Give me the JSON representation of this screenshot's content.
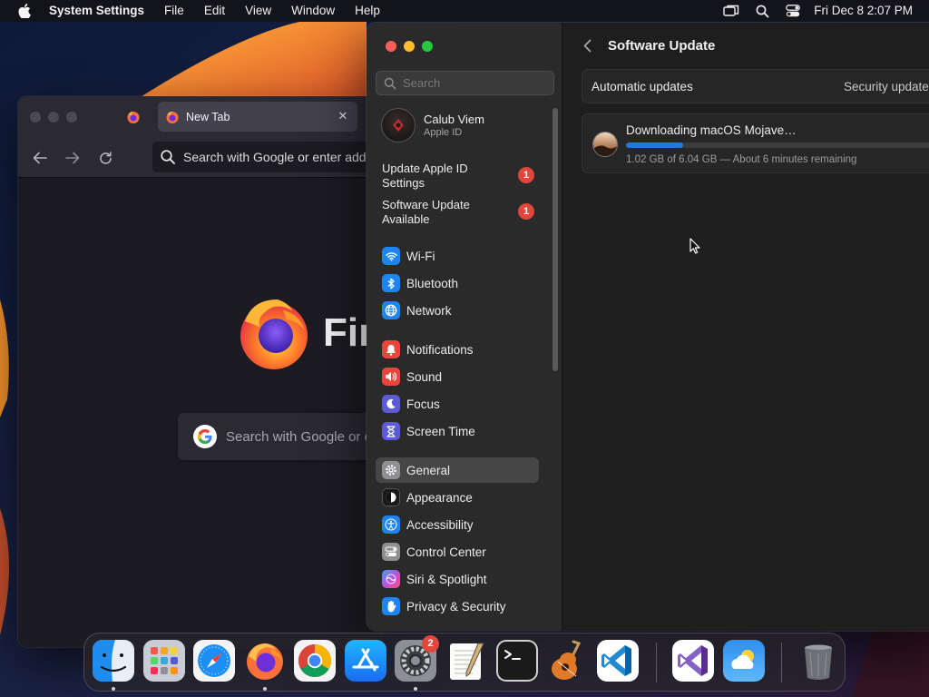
{
  "menubar": {
    "app_name": "System Settings",
    "menus": [
      "File",
      "Edit",
      "View",
      "Window",
      "Help"
    ],
    "clock": "Fri Dec 8  2:07 PM",
    "status_icons": [
      "screen-mirroring-icon",
      "spotlight-search-icon",
      "control-center-icon"
    ]
  },
  "firefox": {
    "tab_title": "New Tab",
    "url_placeholder": "Search with Google or enter address",
    "wordmark": "Firefox",
    "search_placeholder": "Search with Google or enter address"
  },
  "settings": {
    "search_placeholder": "Search",
    "account": {
      "name": "Calub Viem",
      "subtitle": "Apple ID"
    },
    "notices": [
      {
        "label_line1": "Update Apple ID",
        "label_line2": "Settings",
        "badge": "1"
      },
      {
        "label_line1": "Software Update",
        "label_line2": "Available",
        "badge": "1"
      }
    ],
    "nav_items": [
      {
        "label": "Wi-Fi",
        "icon": "wifi-icon",
        "color": "#1e84f0"
      },
      {
        "label": "Bluetooth",
        "icon": "bluetooth-icon",
        "color": "#1e84f0"
      },
      {
        "label": "Network",
        "icon": "globe-icon",
        "color": "#1e84f0"
      },
      {
        "label": "Notifications",
        "icon": "bell-icon",
        "color": "#e8463d"
      },
      {
        "label": "Sound",
        "icon": "speaker-icon",
        "color": "#e8463d"
      },
      {
        "label": "Focus",
        "icon": "moon-icon",
        "color": "#5b5bd6"
      },
      {
        "label": "Screen Time",
        "icon": "hourglass-icon",
        "color": "#5b5bd6"
      },
      {
        "label": "General",
        "icon": "gear-icon",
        "color": "#8e8e93",
        "selected": true
      },
      {
        "label": "Appearance",
        "icon": "appearance-icon",
        "color": "#1a1a1a"
      },
      {
        "label": "Accessibility",
        "icon": "accessibility-icon",
        "color": "#1e84f0"
      },
      {
        "label": "Control Center",
        "icon": "control-center-icon",
        "color": "#8e8e93"
      },
      {
        "label": "Siri & Spotlight",
        "icon": "siri-icon",
        "color": "#b44fd8"
      },
      {
        "label": "Privacy & Security",
        "icon": "hand-icon",
        "color": "#1e84f0"
      }
    ],
    "page_title": "Software Update",
    "automatic_updates_label": "Automatic updates",
    "security_link": "Security updates",
    "download": {
      "title": "Downloading macOS Mojave…",
      "progress": 0.169,
      "detail": "1.02 GB of 6.04 GB — About 6 minutes remaining"
    }
  },
  "dock": {
    "apps": [
      {
        "name": "Finder",
        "icon": "finder-icon",
        "running": true
      },
      {
        "name": "Launchpad",
        "icon": "launchpad-icon",
        "running": false
      },
      {
        "name": "Safari",
        "icon": "safari-icon",
        "running": false
      },
      {
        "name": "Firefox",
        "icon": "firefox-icon",
        "running": true
      },
      {
        "name": "Google Chrome",
        "icon": "chrome-icon",
        "running": false
      },
      {
        "name": "App Store",
        "icon": "app-store-icon",
        "running": false
      },
      {
        "name": "System Settings",
        "icon": "settings-icon",
        "running": true,
        "badge": "2"
      },
      {
        "name": "TextEdit",
        "icon": "textedit-icon",
        "running": false
      },
      {
        "name": "Terminal",
        "icon": "terminal-icon",
        "running": false
      },
      {
        "name": "GarageBand",
        "icon": "garageband-icon",
        "running": false
      },
      {
        "name": "Visual Studio Code",
        "icon": "vscode-icon",
        "running": false
      },
      {
        "name": "Visual Studio",
        "icon": "visual-studio-icon",
        "running": false
      },
      {
        "name": "Weather",
        "icon": "weather-icon",
        "running": false
      },
      {
        "name": "Trash",
        "icon": "trash-icon",
        "running": false
      }
    ]
  },
  "colors": {
    "accent": "#1f7ae0",
    "badge_red": "#e0483e",
    "sidebar_bg": "#2a2a2a"
  }
}
